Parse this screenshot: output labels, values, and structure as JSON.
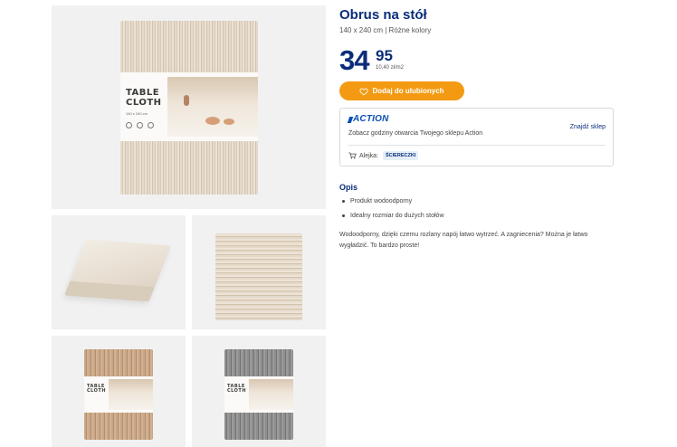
{
  "product": {
    "title": "Obrus na stół",
    "subtitle": "140 x 240 cm | Różne kolory"
  },
  "price": {
    "whole": "34",
    "cents": "95",
    "unit_price": "10,40 zł/m2"
  },
  "favorite": {
    "label": "Dodaj do ulubionych"
  },
  "store": {
    "brand": "ACTION",
    "hours_text": "Zobacz godziny otwarcia Twojego sklepu Action",
    "find_label": "Znajdź sklep",
    "aisle_label": "Alejka:",
    "aisle_value": "ŚCIERECZKI"
  },
  "description": {
    "heading": "Opis",
    "bullets": [
      "Produkt wodoodporny",
      "Idealny rozmiar do dużych stołów"
    ],
    "text": "Wodoodporny, dzięki czemu rozlany napój łatwo wytrzeć. A zagniecenia? Można je łatwo wygładzić. To bardzo proste!"
  },
  "packaging": {
    "title_line1": "TABLE",
    "title_line2": "CLOTH",
    "size": "140 x 240 cm"
  },
  "colors": {
    "brand_blue": "#0a2d7a",
    "action_blue": "#0a4fb5",
    "button_orange": "#f39a12",
    "tile_bg": "#f1f1f1"
  },
  "icons": [
    "heart-icon",
    "cart-icon",
    "action-logo"
  ]
}
